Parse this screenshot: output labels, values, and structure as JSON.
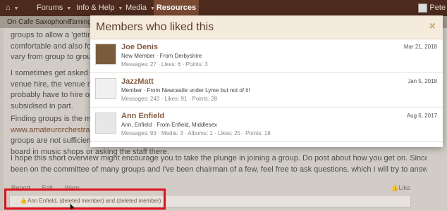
{
  "nav": {
    "home_icon": "home-icon",
    "items": [
      {
        "label": "Forums"
      },
      {
        "label": "Info & Help"
      },
      {
        "label": "Media"
      }
    ],
    "active": "Resources",
    "user": "Pete"
  },
  "subnav": {
    "items": [
      "On Cafe Saxophone",
      "Tarning T"
    ]
  },
  "post": {
    "p1": [
      "groups to allow a 'getting",
      "comfortable and also for b",
      "vary from group to group."
    ],
    "p2": [
      "I sometimes get asked wh",
      "venue hire, the venue may",
      "probably have to hire or pi",
      "subsidised in part."
    ],
    "p3_lines": [
      {
        "text": "Finding groups is the mai"
      },
      {
        "link": "www.amateurorchestras.c"
      },
      {
        "text": "groups are not sufficiently"
      },
      {
        "text": "board in music shops or asking the staff there."
      }
    ],
    "p4": [
      "I hope this short overview might encourage you to take the plunge in joining a group. Do post about how you get on. Since I've",
      "been on the committee of many groups and I've been chairman of a few, feel free to ask questions, which I will try to answer if I can."
    ],
    "actions": [
      "Report",
      "Edit",
      "Warn"
    ],
    "like_label": "Like",
    "likes_text": "Ann Enfield, (deleted member) and (deleted member)"
  },
  "modal": {
    "title": "Members who liked this",
    "close": "×",
    "members": [
      {
        "name": "Joe Denis",
        "title": "New Member · From Derbyshire",
        "stats": "Messages: 27 · Likes: 6 · Points: 3",
        "date": "Mar 21, 2018"
      },
      {
        "name": "JazzMatt",
        "title": "Member · From Newcastle under Lyme but not of it!",
        "stats": "Messages: 243 · Likes: 91 · Points: 28",
        "date": "Jan 5, 2018"
      },
      {
        "name": "Ann Enfield",
        "title": "Ann, Enfield · From Enfield, Middlesex",
        "stats": "Messages: 93 · Media: 3 · Albums: 1 · Likes: 25 · Points: 18",
        "date": "Aug 6, 2017"
      }
    ]
  }
}
